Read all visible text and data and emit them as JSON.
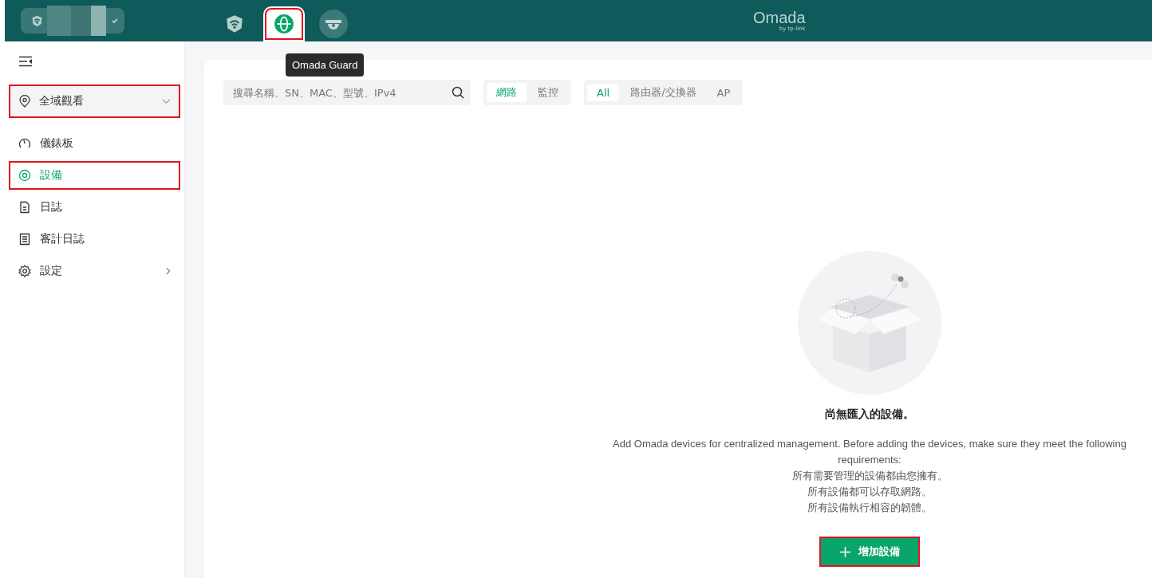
{
  "top_bar": {
    "apps": [
      {
        "kind": "wifi",
        "selected": false,
        "highlighted": false
      },
      {
        "kind": "globe",
        "selected": true,
        "highlighted": true
      },
      {
        "kind": "camera",
        "selected": false,
        "highlighted": false
      }
    ],
    "tooltip": "Omada Guard",
    "logo": {
      "name": "Omada",
      "tagline": "by tp-link"
    }
  },
  "sidebar": {
    "site_selector": {
      "label": "全域觀看",
      "highlighted": true
    },
    "items": [
      {
        "kind": "dashboard",
        "label": "儀錶板",
        "selected": false,
        "highlighted": false,
        "has_submenu": false
      },
      {
        "kind": "devices",
        "label": "設備",
        "selected": true,
        "highlighted": true,
        "has_submenu": false
      },
      {
        "kind": "log",
        "label": "日誌",
        "selected": false,
        "highlighted": false,
        "has_submenu": false
      },
      {
        "kind": "audit",
        "label": "審計日誌",
        "selected": false,
        "highlighted": false,
        "has_submenu": false
      },
      {
        "kind": "settings",
        "label": "設定",
        "selected": false,
        "highlighted": false,
        "has_submenu": true
      }
    ]
  },
  "toolbar": {
    "search": {
      "placeholder": "搜尋名稱、SN、MAC、型號、IPv4"
    },
    "type_tabs": [
      {
        "label": "網路",
        "selected": true
      },
      {
        "label": "監控",
        "selected": false
      }
    ],
    "filter_tabs": [
      {
        "label": "All",
        "selected": true
      },
      {
        "label": "路由器/交換器",
        "selected": false
      },
      {
        "label": "AP",
        "selected": false
      }
    ]
  },
  "empty_state": {
    "title": "尚無匯入的設備。",
    "description": "Add Omada devices for centralized management. Before adding the devices, make sure they meet the following requirements:",
    "requirements": [
      "所有需要管理的設備都由您擁有。",
      "所有設備都可以存取網路。",
      "所有設備執行相容的韌體。"
    ],
    "button": {
      "label": "增加設備",
      "highlighted": true
    }
  }
}
